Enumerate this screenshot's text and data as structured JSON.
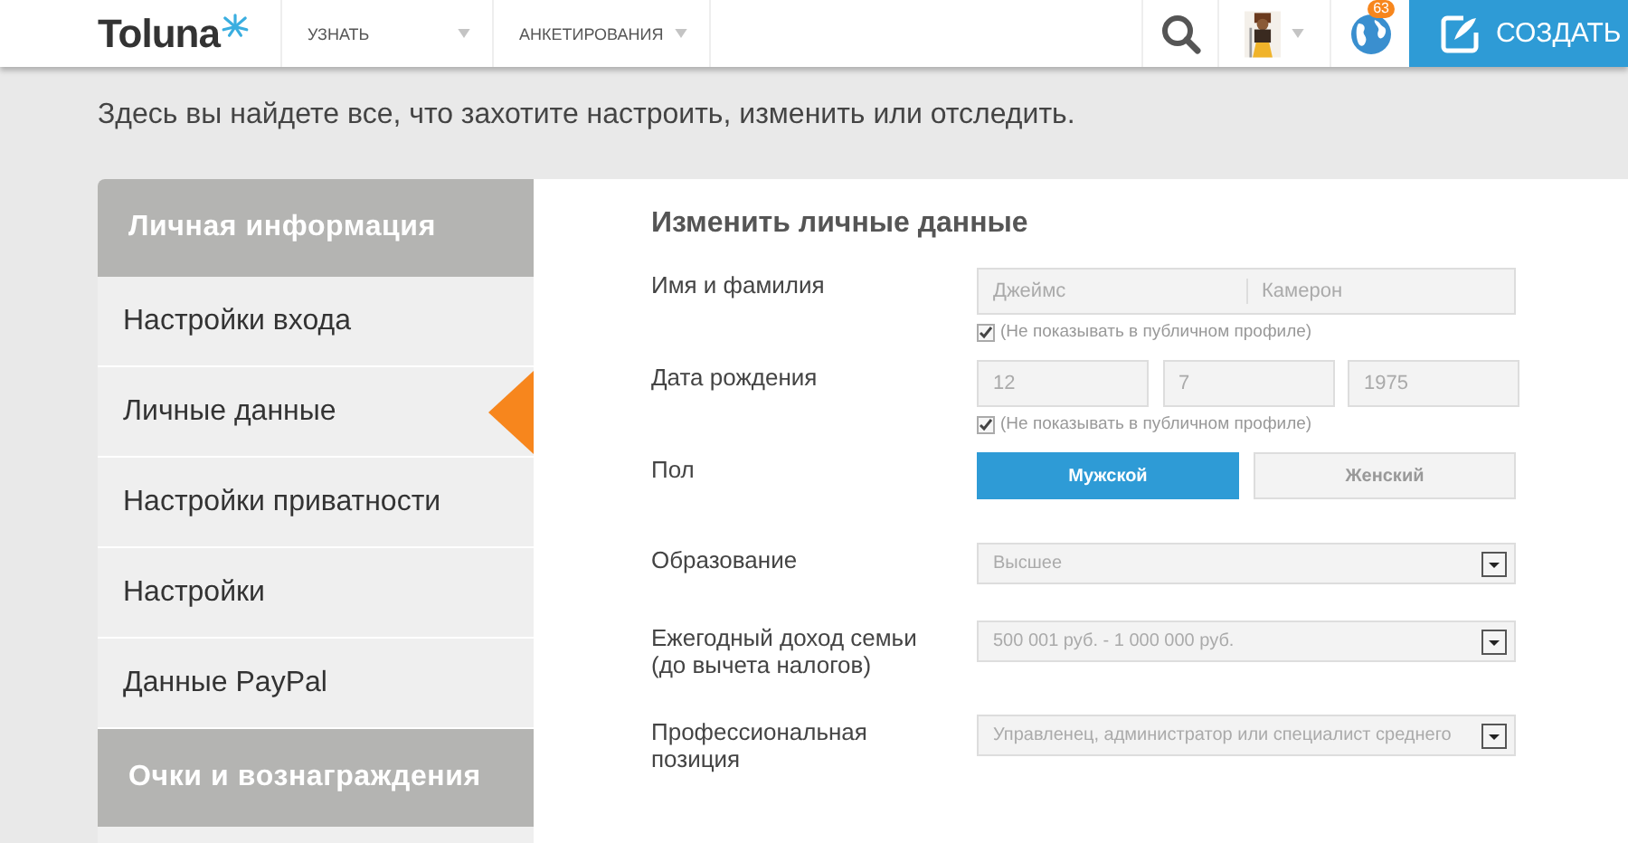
{
  "header": {
    "logo": "Toluna",
    "nav": [
      {
        "label": "УЗНАТЬ"
      },
      {
        "label": "АНКЕТИРОВАНИЯ"
      }
    ],
    "notifications": "63",
    "create_button": "СОЗДАТЬ"
  },
  "page": {
    "subtitle": "Здесь вы найдете все, что захотите настроить, изменить или отследить."
  },
  "sidebar": {
    "sections": [
      {
        "title": "Личная информация",
        "items": [
          {
            "label": "Настройки входа",
            "selected": false
          },
          {
            "label": "Личные данные",
            "selected": true
          },
          {
            "label": "Настройки приватности",
            "selected": false
          },
          {
            "label": "Настройки",
            "selected": false
          },
          {
            "label": "Данные PayPal",
            "selected": false
          }
        ]
      },
      {
        "title": "Очки и вознаграждения"
      }
    ]
  },
  "form": {
    "title": "Изменить личные данные",
    "rows": [
      {
        "kind": "name",
        "label": "Имя и фамилия",
        "values": [
          "Джеймс",
          "Камерон"
        ],
        "note": {
          "checked": true,
          "text": "(Не показывать в публичном профиле)"
        }
      },
      {
        "kind": "date",
        "label": "Дата рождения",
        "values": [
          "12",
          "7",
          "1975"
        ],
        "note": {
          "checked": true,
          "text": "(Не показывать в публичном профиле)"
        }
      },
      {
        "kind": "choice",
        "label": "Пол",
        "options": [
          {
            "label": "Мужской",
            "selected": true
          },
          {
            "label": "Женский",
            "selected": false
          }
        ]
      },
      {
        "kind": "select",
        "label": "Образование",
        "value": "Высшее"
      },
      {
        "kind": "select",
        "label": "Ежегодный доход семьи (до вычета налогов)",
        "value": "500 001 руб. - 1 000 000 руб."
      },
      {
        "kind": "select",
        "label": "Профессиональная позиция",
        "value": "Управленец, администратор или специалист среднего"
      }
    ]
  }
}
